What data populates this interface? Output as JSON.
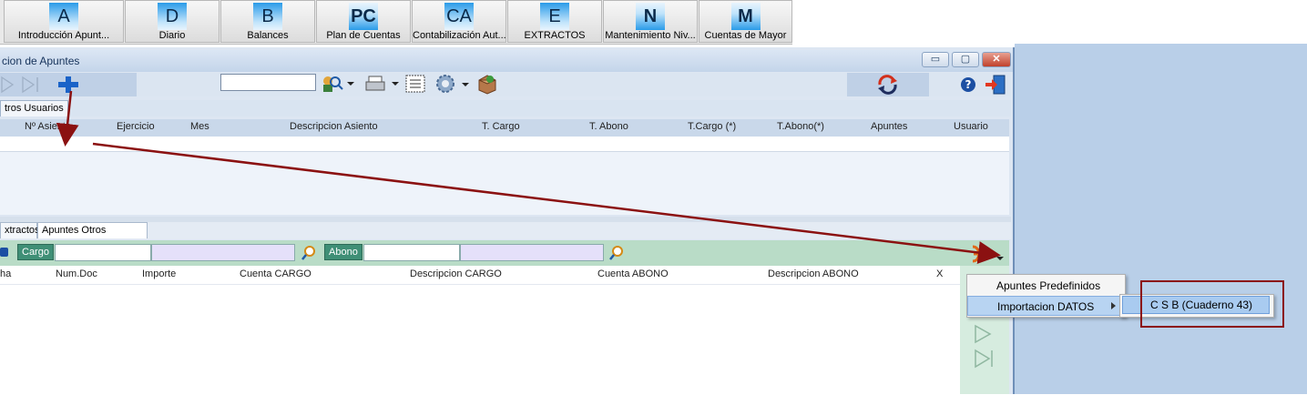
{
  "top_toolbar": [
    {
      "letter": "A",
      "label": "Introducción Apunt..."
    },
    {
      "letter": "D",
      "label": "Diario"
    },
    {
      "letter": "B",
      "label": "Balances"
    },
    {
      "letter": "PC",
      "label": "Plan de Cuentas"
    },
    {
      "letter": "CA",
      "label": "Contabilización Aut..."
    },
    {
      "letter": "E",
      "label": "EXTRACTOS"
    },
    {
      "letter": "N",
      "label": "Mantenimiento Niv..."
    },
    {
      "letter": "M",
      "label": "Cuentas de Mayor"
    }
  ],
  "window": {
    "title": "cion de Apuntes",
    "min_glyph": "▭",
    "max_glyph": "▢",
    "close_glyph": "✕"
  },
  "toolbar": {
    "search_value": ""
  },
  "upper_tab": "tros Usuarios",
  "upper_grid": {
    "columns": [
      "Nº Asiento",
      "Ejercicio",
      "Mes",
      "Descripcion Asiento",
      "T. Cargo",
      "T. Abono",
      "T.Cargo (*)",
      "T.Abono(*)",
      "Apuntes",
      "Usuario"
    ]
  },
  "lower_tabs": [
    "xtractos",
    "Apuntes Otros Usuarios"
  ],
  "filter": {
    "cargo_label": "Cargo",
    "abono_label": "Abono"
  },
  "lower_grid": {
    "columns": [
      "ha",
      "Num.Doc",
      "Importe",
      "Cuenta CARGO",
      "Descripcion CARGO",
      "Cuenta ABONO",
      "Descripcion ABONO",
      "X"
    ]
  },
  "context_menu": {
    "items": [
      "Apuntes Predefinidos",
      "Importacion DATOS"
    ],
    "submenu_item": "C S B (Cuaderno 43)"
  },
  "colors": {
    "annotation_red": "#8b1111",
    "window_blue": "#b9cfe8",
    "filter_green": "#b9dcc7"
  }
}
